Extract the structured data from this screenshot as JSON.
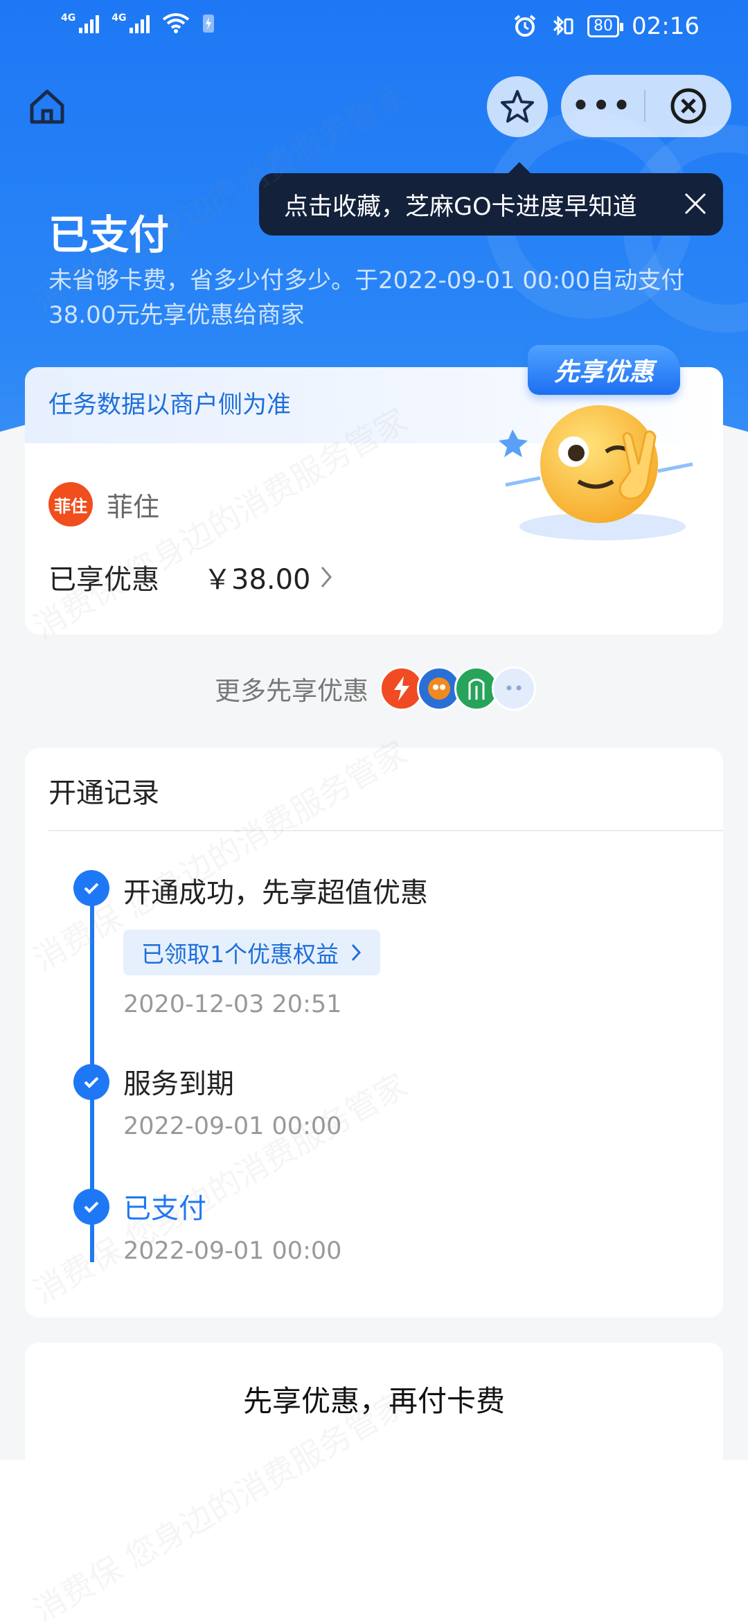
{
  "status_bar": {
    "net1": "4G",
    "net2": "4G",
    "battery": "80",
    "time": "02:16"
  },
  "tooltip": {
    "text": "点击收藏，芝麻GO卡进度早知道"
  },
  "capsule": {
    "more_label": "•••"
  },
  "header": {
    "title": "已支付",
    "description": "未省够卡费，省多少付多少。于2022-09-01 00:00自动支付38.00元先享优惠给商家"
  },
  "card": {
    "notice": "任务数据以商户侧为准",
    "badge": "先享优惠",
    "merchant_logo_text": "菲住",
    "merchant_name": "菲住",
    "benefit_label": "已享优惠",
    "benefit_amount": "￥38.00"
  },
  "more": {
    "label": "更多先享优惠"
  },
  "records": {
    "title": "开通记录",
    "items": [
      {
        "title": "开通成功，先享超值优惠",
        "chip": "已领取1个优惠权益",
        "time": "2020-12-03 20:51"
      },
      {
        "title": "服务到期",
        "time": "2022-09-01 00:00"
      },
      {
        "title": "已支付",
        "time": "2022-09-01 00:00"
      }
    ]
  },
  "footer": {
    "text": "先享优惠，再付卡费"
  },
  "watermark": "消费保 您身边的消费服务管家",
  "colors": {
    "primary": "#1e78f5",
    "tooltip_bg": "#13213b",
    "merchant": "#f14e1d"
  }
}
